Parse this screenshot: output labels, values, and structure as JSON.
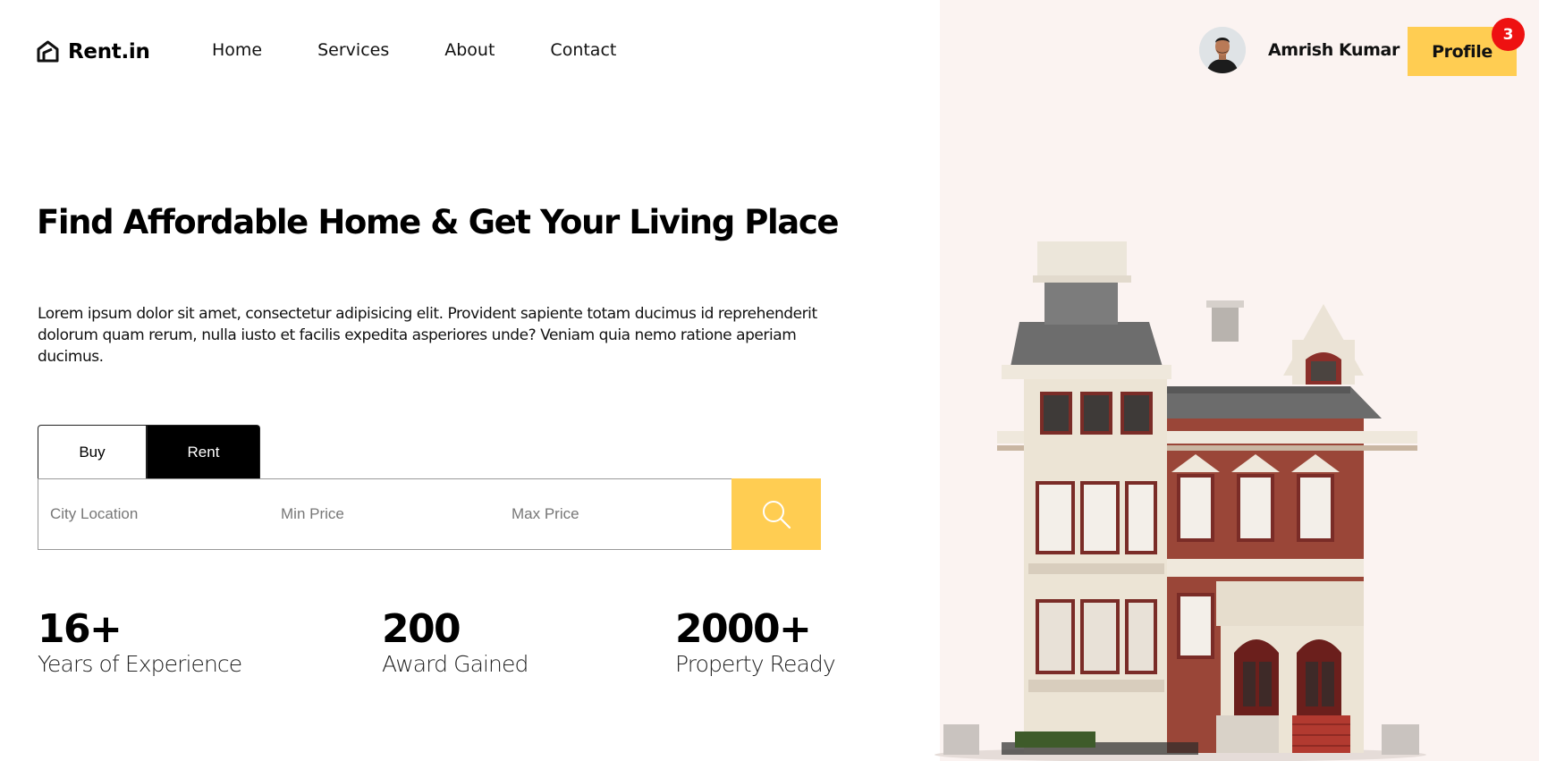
{
  "brand": {
    "name": "Rent.in",
    "icon": "house-logo-icon"
  },
  "nav": {
    "items": [
      {
        "label": "Home"
      },
      {
        "label": "Services"
      },
      {
        "label": "About"
      },
      {
        "label": "Contact"
      }
    ]
  },
  "user": {
    "name": "Amrish Kumar",
    "avatar": "user-avatar"
  },
  "profile": {
    "label": "Profile",
    "badge_count": "3"
  },
  "hero": {
    "title": "Find Affordable Home & Get Your Living Place",
    "description": "Lorem ipsum dolor sit amet, consectetur adipisicing elit. Provident sapiente totam ducimus id reprehenderit dolorum quam rerum, nulla iusto et facilis expedita asperiores unde? Veniam quia nemo ratione aperiam ducimus."
  },
  "search": {
    "tabs": [
      {
        "label": "Buy"
      },
      {
        "label": "Rent"
      }
    ],
    "active_tab": "Rent",
    "fields": [
      {
        "placeholder": "City Location",
        "value": ""
      },
      {
        "placeholder": "Min Price",
        "value": ""
      },
      {
        "placeholder": "Max Price",
        "value": ""
      }
    ],
    "button_icon": "search-icon"
  },
  "stats": [
    {
      "value": "16+",
      "label": "Years of Experience"
    },
    {
      "value": "200",
      "label": "Award Gained"
    },
    {
      "value": "2000+",
      "label": "Property Ready"
    }
  ],
  "colors": {
    "accent": "#ffcd52",
    "badge": "#ee1111",
    "panel_bg": "#fbf3f1",
    "tab_active_bg": "#000000"
  },
  "images": {
    "hero": "victorian-house-image"
  }
}
